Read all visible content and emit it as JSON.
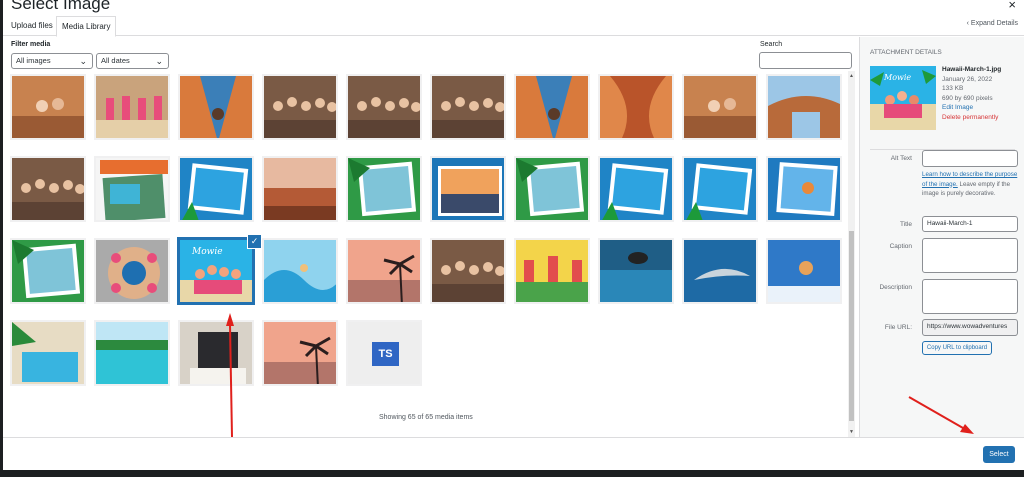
{
  "modal": {
    "title": "Select Image",
    "close_glyph": "×",
    "tabs": [
      {
        "label": "Upload files",
        "active": false
      },
      {
        "label": "Media Library",
        "active": true
      }
    ],
    "expand_details": "‹ Expand Details"
  },
  "filters": {
    "label": "Filter media",
    "type_select": "All images",
    "date_select": "All dates",
    "chevron": "⌄"
  },
  "search": {
    "label": "Search",
    "value": ""
  },
  "media_grid": {
    "total_shown_text": "Showing 65 of 65 media items",
    "selected_index": 22,
    "selected_check": "✓",
    "ts_placeholder_text": "TS",
    "scroll_up_glyph": "▲",
    "scroll_down_glyph": "▼",
    "items": [
      {
        "kind": "desert-canyon"
      },
      {
        "kind": "beach-group"
      },
      {
        "kind": "slot-canyon"
      },
      {
        "kind": "group-rocks"
      },
      {
        "kind": "group-rocks"
      },
      {
        "kind": "group-rocks"
      },
      {
        "kind": "slot-canyon"
      },
      {
        "kind": "slot-canyon-orange"
      },
      {
        "kind": "desert-canyon"
      },
      {
        "kind": "arch-canyon"
      },
      {
        "kind": "group-rocks"
      },
      {
        "kind": "collage-orange"
      },
      {
        "kind": "collage-blue"
      },
      {
        "kind": "desert-vista"
      },
      {
        "kind": "collage-green"
      },
      {
        "kind": "sunset-collage"
      },
      {
        "kind": "collage-green"
      },
      {
        "kind": "collage-blue"
      },
      {
        "kind": "collage-blue"
      },
      {
        "kind": "collage-skydive"
      },
      {
        "kind": "collage-green"
      },
      {
        "kind": "circle-group"
      },
      {
        "kind": "hawaii-collage"
      },
      {
        "kind": "surf-collage"
      },
      {
        "kind": "palm-sunset"
      },
      {
        "kind": "group-rocks"
      },
      {
        "kind": "colorful-group"
      },
      {
        "kind": "helicopter-sea"
      },
      {
        "kind": "dolphin-sea"
      },
      {
        "kind": "skydive-sky"
      },
      {
        "kind": "pool-resort"
      },
      {
        "kind": "turquoise-beach"
      },
      {
        "kind": "business-man"
      },
      {
        "kind": "palm-sunset"
      },
      {
        "kind": "ts-placeholder"
      }
    ]
  },
  "attachment": {
    "heading": "Attachment Details",
    "filename": "Hawaii-March-1.jpg",
    "date": "January 26, 2022",
    "size": "133 KB",
    "dimensions": "690 by 690 pixels",
    "edit_link": "Edit Image",
    "delete_link": "Delete permanently",
    "fields": {
      "alt_label": "Alt Text",
      "alt_value": "",
      "alt_help_link": "Learn how to describe the purpose of the image.",
      "alt_help_text": " Leave empty if the image is purely decorative.",
      "title_label": "Title",
      "title_value": "Hawaii-March-1",
      "caption_label": "Caption",
      "caption_value": "",
      "description_label": "Description",
      "description_value": "",
      "url_label": "File URL:",
      "url_value": "https://www.wowadventures",
      "copy_button": "Copy URL to clipboard"
    }
  },
  "toolbar": {
    "select_button": "Select"
  },
  "colors": {
    "accent": "#2271b1",
    "annotation_arrow": "#e0201c",
    "delete": "#d63638"
  }
}
